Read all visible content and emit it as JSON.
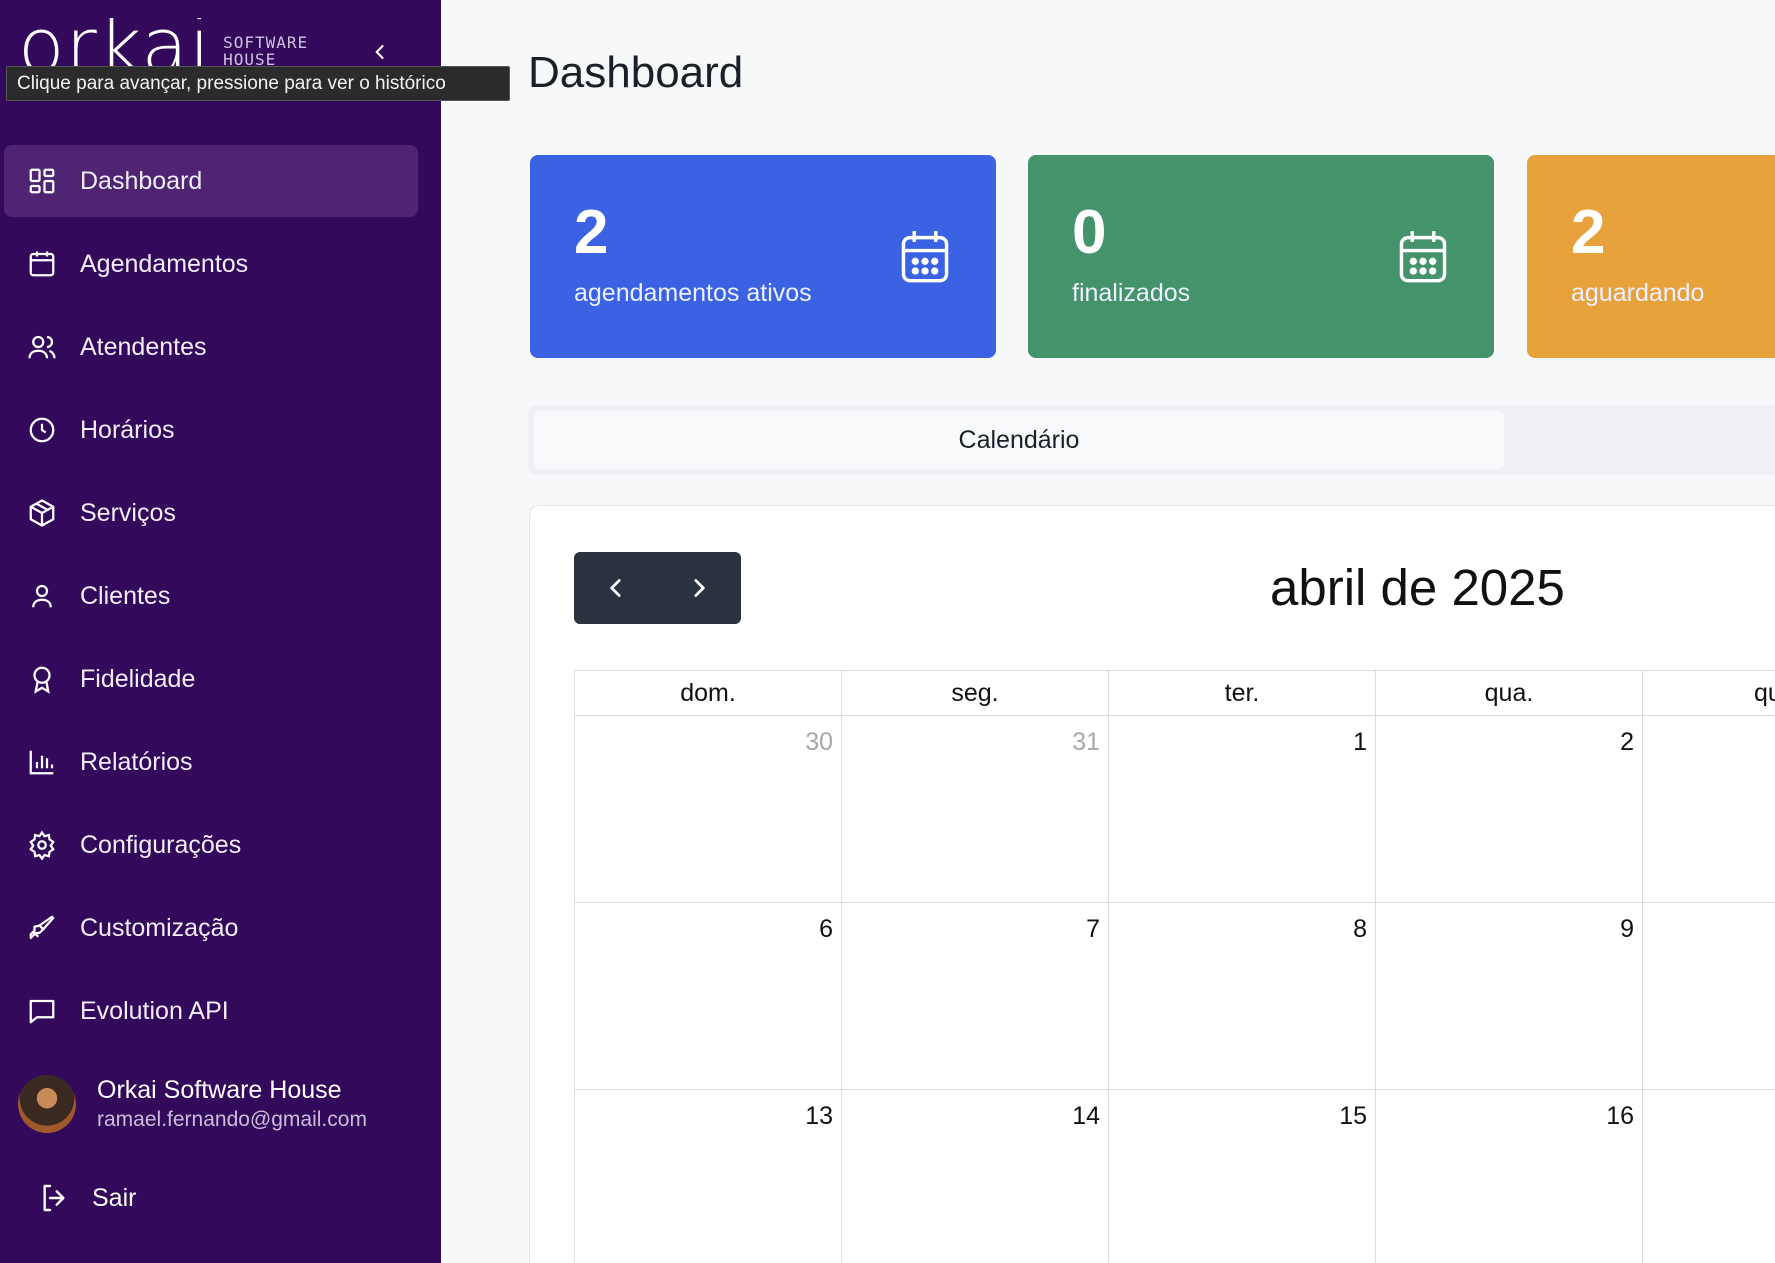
{
  "sidebar": {
    "logo_text": "orkai",
    "logo_sub": "SOFTWARE HOUSE",
    "tooltip": "Clique para avançar, pressione para ver o histórico",
    "items": [
      {
        "label": "Dashboard",
        "icon": "dashboard-icon",
        "active": true
      },
      {
        "label": "Agendamentos",
        "icon": "calendar-icon"
      },
      {
        "label": "Atendentes",
        "icon": "users-icon"
      },
      {
        "label": "Horários",
        "icon": "clock-icon"
      },
      {
        "label": "Serviços",
        "icon": "package-icon"
      },
      {
        "label": "Clientes",
        "icon": "user-icon"
      },
      {
        "label": "Fidelidade",
        "icon": "award-icon"
      },
      {
        "label": "Relatórios",
        "icon": "bar-chart-icon"
      },
      {
        "label": "Configurações",
        "icon": "gear-icon"
      },
      {
        "label": "Customização",
        "icon": "paintbrush-icon"
      },
      {
        "label": "Evolution API",
        "icon": "message-icon"
      }
    ],
    "user": {
      "name": "Orkai Software House",
      "email": "ramael.fernando@gmail.com"
    },
    "logout_label": "Sair",
    "bg_color": "#33095b"
  },
  "main": {
    "title": "Dashboard",
    "stats": [
      {
        "value": "2",
        "label": "agendamentos ativos",
        "color": "#3a62e3"
      },
      {
        "value": "0",
        "label": "finalizados",
        "color": "#44936b"
      },
      {
        "value": "2",
        "label": "aguardando",
        "color": "#e8a23c"
      }
    ],
    "tabs": [
      {
        "label": "Calendário"
      }
    ],
    "calendar": {
      "month": "abril de 2025",
      "weekdays": [
        "dom.",
        "seg.",
        "ter.",
        "qua.",
        "qu"
      ],
      "weeks": [
        [
          "30",
          "31",
          "1",
          "2"
        ],
        [
          "6",
          "7",
          "8",
          "9"
        ],
        [
          "13",
          "14",
          "15",
          "16"
        ]
      ]
    }
  }
}
